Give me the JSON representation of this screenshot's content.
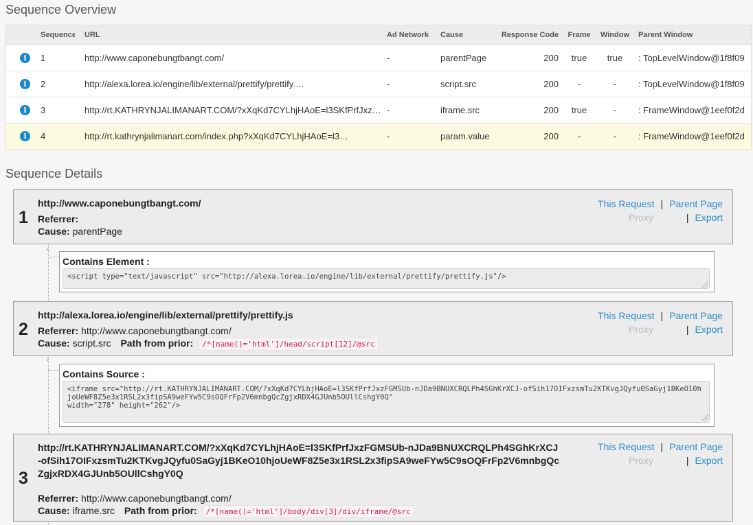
{
  "overview": {
    "title": "Sequence Overview",
    "columns": {
      "sequence": "Sequence",
      "url": "URL",
      "ad_network": "Ad Network",
      "cause": "Cause",
      "response_code": "Response Code",
      "frame": "Frame",
      "window": "Window",
      "parent_window": "Parent Window"
    },
    "rows": [
      {
        "seq": "1",
        "url": "http://www.caponebungtbangt.com/",
        "ad": "-",
        "cause": "parentPage",
        "resp": "200",
        "frame": "true",
        "window": "true",
        "parent": ": TopLevelWindow@1f8f09"
      },
      {
        "seq": "2",
        "url": "http://alexa.lorea.io/engine/lib/external/prettify/prettify.…",
        "ad": "-",
        "cause": "script.src",
        "resp": "200",
        "frame": "-",
        "window": "-",
        "parent": ": TopLevelWindow@1f8f09"
      },
      {
        "seq": "3",
        "url": "http://rt.KATHRYNJALIMANART.COM/?xXqKd7CYLhjHAoE=l3SKfPrfJxz…",
        "ad": "-",
        "cause": "iframe.src",
        "resp": "200",
        "frame": "true",
        "window": "-",
        "parent": ": FrameWindow@1eef0f2d"
      },
      {
        "seq": "4",
        "url": "http://rt.kathrynjalimanart.com/index.php?xXqKd7CYLhjHAoE=l3…",
        "ad": "-",
        "cause": "param.value",
        "resp": "200",
        "frame": "-",
        "window": "-",
        "parent": ": FrameWindow@1eef0f2d"
      }
    ],
    "info_icon_glyph": "i"
  },
  "details": {
    "title": "Sequence Details",
    "labels": {
      "referrer": "Referrer:",
      "cause": "Cause:",
      "path_from_prior": "Path from prior:",
      "this_request": "This Request",
      "parent_page": "Parent Page",
      "proxy": "Proxy",
      "export": "Export",
      "separator": "|",
      "contains_element": "Contains Element :",
      "contains_source": "Contains Source :"
    },
    "items": [
      {
        "num": "1",
        "url": "http://www.caponebungtbangt.com/",
        "referrer": "",
        "cause": "parentPage",
        "path": ""
      },
      {
        "num": "2",
        "url": "http://alexa.lorea.io/engine/lib/external/prettify/prettify.js",
        "referrer": "http://www.caponebungtbangt.com/",
        "cause": "script.src",
        "path": "/*[name()='html']/head/script[12]/@src"
      },
      {
        "num": "3",
        "url": "http://rt.KATHRYNJALIMANART.COM/?xXqKd7CYLhjHAoE=l3SKfPrfJxzFGMSUb-nJDa9BNUXCRQLPh4SGhKrXCJ-ofSih17OIFxzsmTu2KTKvgJQyfu0SaGyj1BKeO10hjoUeWF8Z5e3x1RSL2x3fipSA9weFYw5C9sOQFrFp2V6mnbgQcZgjxRDX4GJUnb5OUllCshgY0Q",
        "referrer": "http://www.caponebungtbangt.com/",
        "cause": "iframe.src",
        "path": "/*[name()='html']/body/div[3]/div/iframe/@src"
      }
    ],
    "contains_element_code": "<script type=\"text/javascript\" src=\"http://alexa.lorea.io/engine/lib/external/prettify/prettify.js\"/>",
    "contains_source_code": "<iframe src=\"http://rt.KATHRYNJALIMANART.COM/?xXqKd7CYLhjHAoE=l3SKfPrfJxzFGMSUb-nJDa9BNUXCRQLPh4SGhKrXCJ-ofSih17OIFxzsmTu2KTKvgJQyfu0SaGyj1BKeO10hjoUeWF8Z5e3x1RSL2x3fipSA9weFYw5C9sOQFrFp2V6mnbgQcZgjxRDX4GJUnb5OUllCshgY0Q\"\nwidth=\"278\" height=\"262\"/>"
  },
  "colors": {
    "link": "#2a8cc7",
    "highlight_row": "#fcfbdf",
    "code_red": "#c7254e",
    "info_blue": "#1a87c9"
  }
}
